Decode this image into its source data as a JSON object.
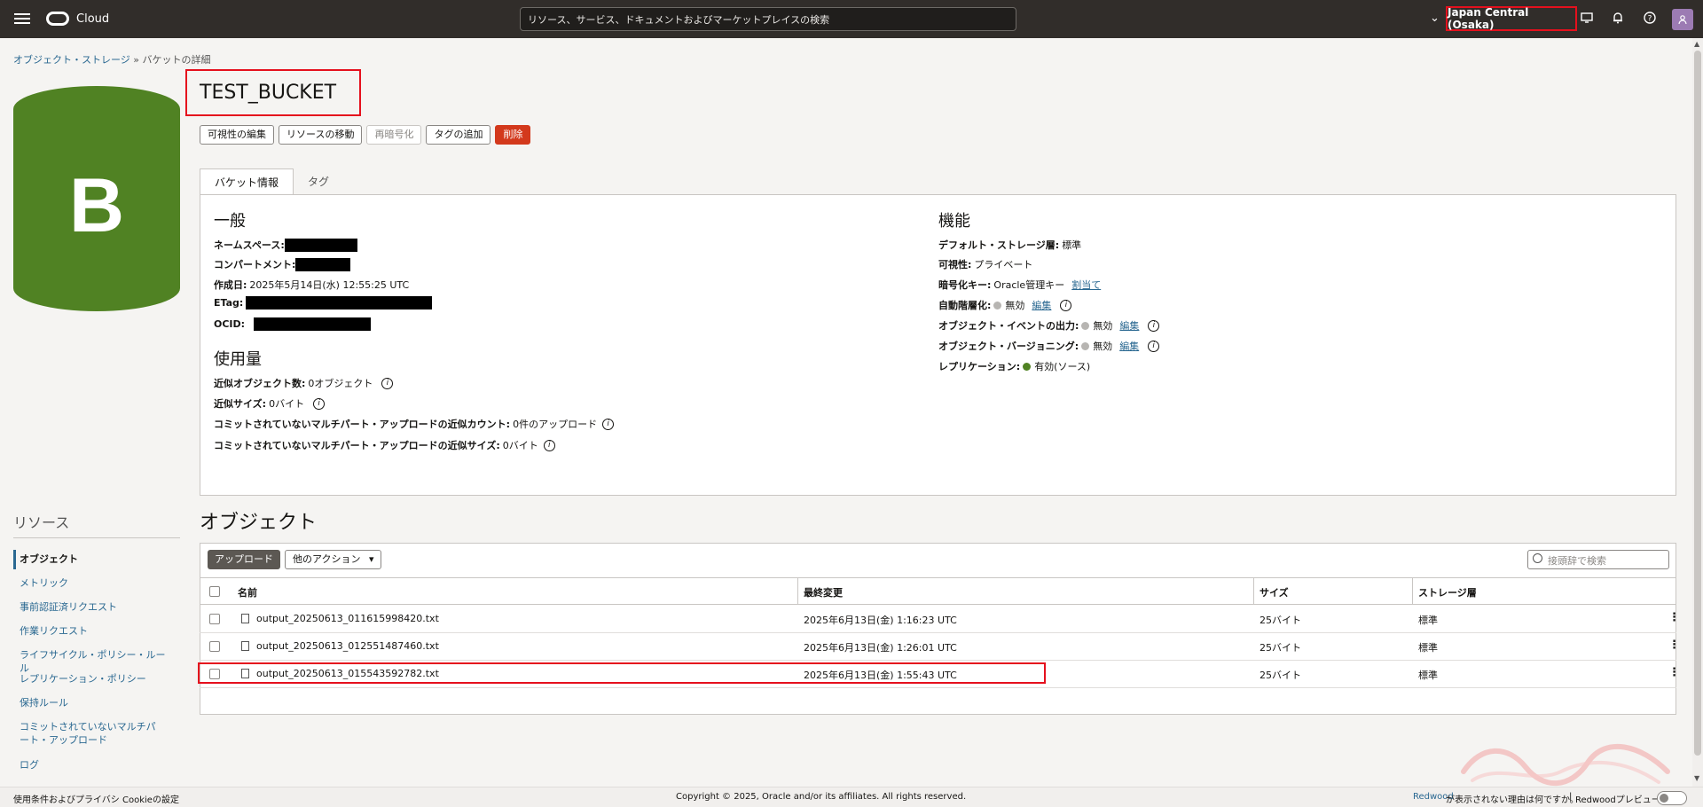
{
  "header": {
    "brand": "Cloud",
    "search_placeholder": "リソース、サービス、ドキュメントおよびマーケットプレイスの検索",
    "region": "Japan Central (Osaka)"
  },
  "breadcrumb": {
    "root": "オブジェクト・ストレージ",
    "separator": "»",
    "current": "バケットの詳細"
  },
  "bucket_icon": {
    "letter": "B",
    "color": "#508223"
  },
  "bucket": {
    "name": "TEST_BUCKET"
  },
  "actions": {
    "edit_visibility": "可視性の編集",
    "move_resource": "リソースの移動",
    "re_encrypt": "再暗号化",
    "add_tags": "タグの追加",
    "delete": "削除"
  },
  "tabs": {
    "bucket_info": "バケット情報",
    "tags": "タグ"
  },
  "general": {
    "heading": "一般",
    "namespace_label": "ネームスペース:",
    "compartment_label": "コンパートメント:",
    "created_label": "作成日:",
    "created_value": "2025年5月14日(水) 12:55:25 UTC",
    "etag_label": "ETag:",
    "ocid_label": "OCID:"
  },
  "usage": {
    "heading": "使用量",
    "approx_objects_label": "近似オブジェクト数:",
    "approx_objects_value": "0オブジェクト",
    "approx_size_label": "近似サイズ:",
    "approx_size_value": "0バイト",
    "uncommitted_count_label": "コミットされていないマルチパート・アップロードの近似カウント:",
    "uncommitted_count_value": "0件のアップロード",
    "uncommitted_size_label": "コミットされていないマルチパート・アップロードの近似サイズ:",
    "uncommitted_size_value": "0バイト"
  },
  "features": {
    "heading": "機能",
    "storage_tier_label": "デフォルト・ストレージ層:",
    "storage_tier_value": "標準",
    "visibility_label": "可視性:",
    "visibility_value": "プライベート",
    "encryption_label": "暗号化キー:",
    "encryption_value": "Oracle管理キー",
    "encryption_link": "割当て",
    "auto_tiering_label": "自動階層化:",
    "auto_tiering_value": "無効",
    "object_events_label": "オブジェクト・イベントの出力:",
    "object_events_value": "無効",
    "versioning_label": "オブジェクト・バージョニング:",
    "versioning_value": "無効",
    "replication_label": "レプリケーション:",
    "replication_value": "有効(ソース)",
    "edit_link": "編集"
  },
  "resources": {
    "title": "リソース",
    "items": [
      {
        "label": "オブジェクト"
      },
      {
        "label": "メトリック"
      },
      {
        "label": "事前認証済リクエスト"
      },
      {
        "label": "作業リクエスト"
      },
      {
        "label": "ライフサイクル・ポリシー・ルール"
      },
      {
        "label": "レプリケーション・ポリシー"
      },
      {
        "label": "保持ルール"
      },
      {
        "label": "コミットされていないマルチパート・アップロード"
      },
      {
        "label": "ログ"
      }
    ]
  },
  "objects": {
    "title": "オブジェクト",
    "upload": "アップロード",
    "more_actions": "他のアクション",
    "search_placeholder": "接頭辞で検索",
    "columns": {
      "name": "名前",
      "modified": "最終変更",
      "size": "サイズ",
      "tier": "ストレージ層"
    },
    "rows": [
      {
        "name": "output_20250613_011615998420.txt",
        "modified": "2025年6月13日(金) 1:16:23 UTC",
        "size": "25バイト",
        "tier": "標準"
      },
      {
        "name": "output_20250613_012551487460.txt",
        "modified": "2025年6月13日(金) 1:26:01 UTC",
        "size": "25バイト",
        "tier": "標準"
      },
      {
        "name": "output_20250613_015543592782.txt",
        "modified": "2025年6月13日(金) 1:55:43 UTC",
        "size": "25バイト",
        "tier": "標準"
      }
    ]
  },
  "footer": {
    "terms": "使用条件およびプライバシ",
    "cookies": "Cookieの設定",
    "copyright": "Copyright © 2025, Oracle and/or its affiliates. All rights reserved.",
    "redwood_link": "Redwood",
    "redwood_text": "が表示されない理由は何ですか。",
    "separator": "|",
    "redwood_preview": "Redwoodプレビュー"
  },
  "colors": {
    "accent_red": "#e5101d",
    "header_bg": "#312d2a",
    "bucket_green": "#508223",
    "link": "#2a6891"
  }
}
